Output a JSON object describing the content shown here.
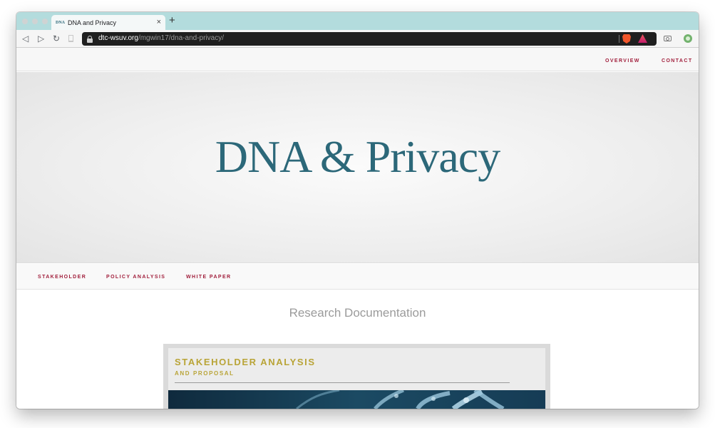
{
  "browser": {
    "tab": {
      "favicon_text": "DNA",
      "title": "DNA and Privacy",
      "close_glyph": "×"
    },
    "new_tab_glyph": "+",
    "nav": {
      "back_glyph": "◁",
      "forward_glyph": "▷",
      "reload_glyph": "↻"
    },
    "address": {
      "domain": "dtc-wsuv.org",
      "path": "/mgwin17/dna-and-privacy/"
    }
  },
  "site": {
    "top_nav": [
      {
        "label": "OVERVIEW"
      },
      {
        "label": "CONTACT"
      }
    ],
    "hero_title": "DNA & Privacy",
    "sub_nav": [
      {
        "label": "STAKEHOLDER"
      },
      {
        "label": "POLICY ANALYSIS"
      },
      {
        "label": "WHITE PAPER"
      }
    ],
    "section_title": "Research Documentation",
    "card": {
      "title": "STAKEHOLDER ANALYSIS",
      "subtitle": "AND PROPOSAL"
    }
  },
  "colors": {
    "tabstrip": "#b3dcdd",
    "hero_title": "#2c6879",
    "nav_link": "#a11f3c",
    "card_heading": "#b9a437"
  }
}
